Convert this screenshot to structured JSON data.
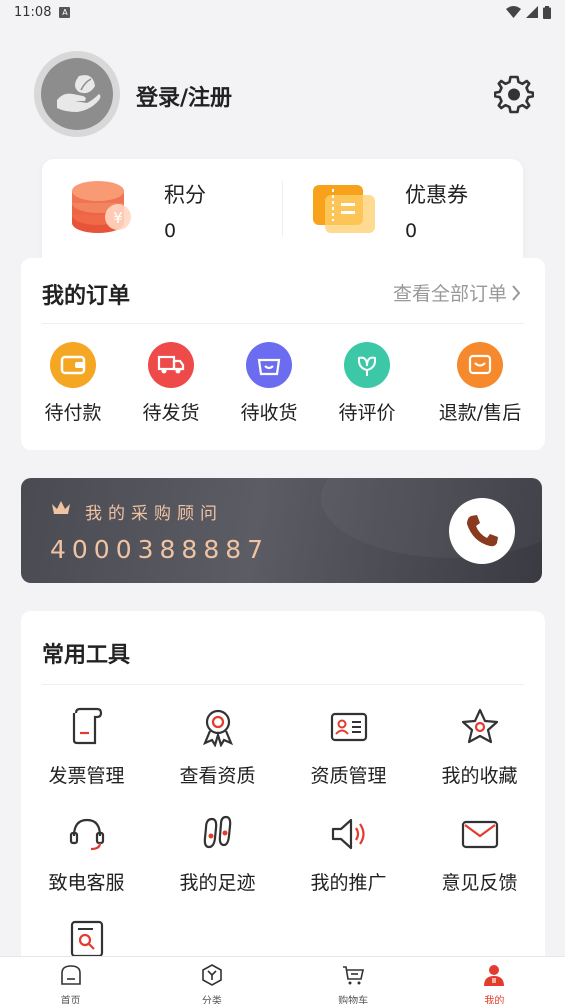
{
  "status": {
    "time": "11:08",
    "notif_icon": "A"
  },
  "profile": {
    "login_label": "登录/注册"
  },
  "points": {
    "points_label": "积分",
    "points_value": "0",
    "coupon_label": "优惠券",
    "coupon_value": "0"
  },
  "orders": {
    "title": "我的订单",
    "view_all": "查看全部订单",
    "items": [
      {
        "label": "待付款",
        "color": "#f5a623",
        "icon": "wallet-icon"
      },
      {
        "label": "待发货",
        "color": "#ef4a4a",
        "icon": "truck-icon"
      },
      {
        "label": "待收货",
        "color": "#6c6cf0",
        "icon": "basket-icon"
      },
      {
        "label": "待评价",
        "color": "#3cc8a6",
        "icon": "flower-icon"
      },
      {
        "label": "退款/售后",
        "color": "#f5892c",
        "icon": "refund-icon"
      }
    ]
  },
  "advisor": {
    "title": "我的采购顾问",
    "phone": "4000388887"
  },
  "tools": {
    "title": "常用工具",
    "items": [
      {
        "label": "发票管理",
        "icon": "receipt-icon"
      },
      {
        "label": "查看资质",
        "icon": "badge-icon"
      },
      {
        "label": "资质管理",
        "icon": "id-card-icon"
      },
      {
        "label": "我的收藏",
        "icon": "star-icon"
      },
      {
        "label": "致电客服",
        "icon": "headset-icon"
      },
      {
        "label": "我的足迹",
        "icon": "footprint-icon"
      },
      {
        "label": "我的推广",
        "icon": "megaphone-icon"
      },
      {
        "label": "意见反馈",
        "icon": "mail-icon"
      },
      {
        "label": "",
        "icon": "search-document-icon"
      }
    ]
  },
  "tabbar": {
    "items": [
      {
        "label": "首页",
        "icon": "home-icon"
      },
      {
        "label": "分类",
        "icon": "category-icon"
      },
      {
        "label": "购物车",
        "icon": "cart-icon"
      },
      {
        "label": "我的",
        "icon": "user-icon",
        "active": true
      }
    ]
  },
  "colors": {
    "accent": "#e33b2e",
    "advisor_text": "#f0c3a2"
  }
}
